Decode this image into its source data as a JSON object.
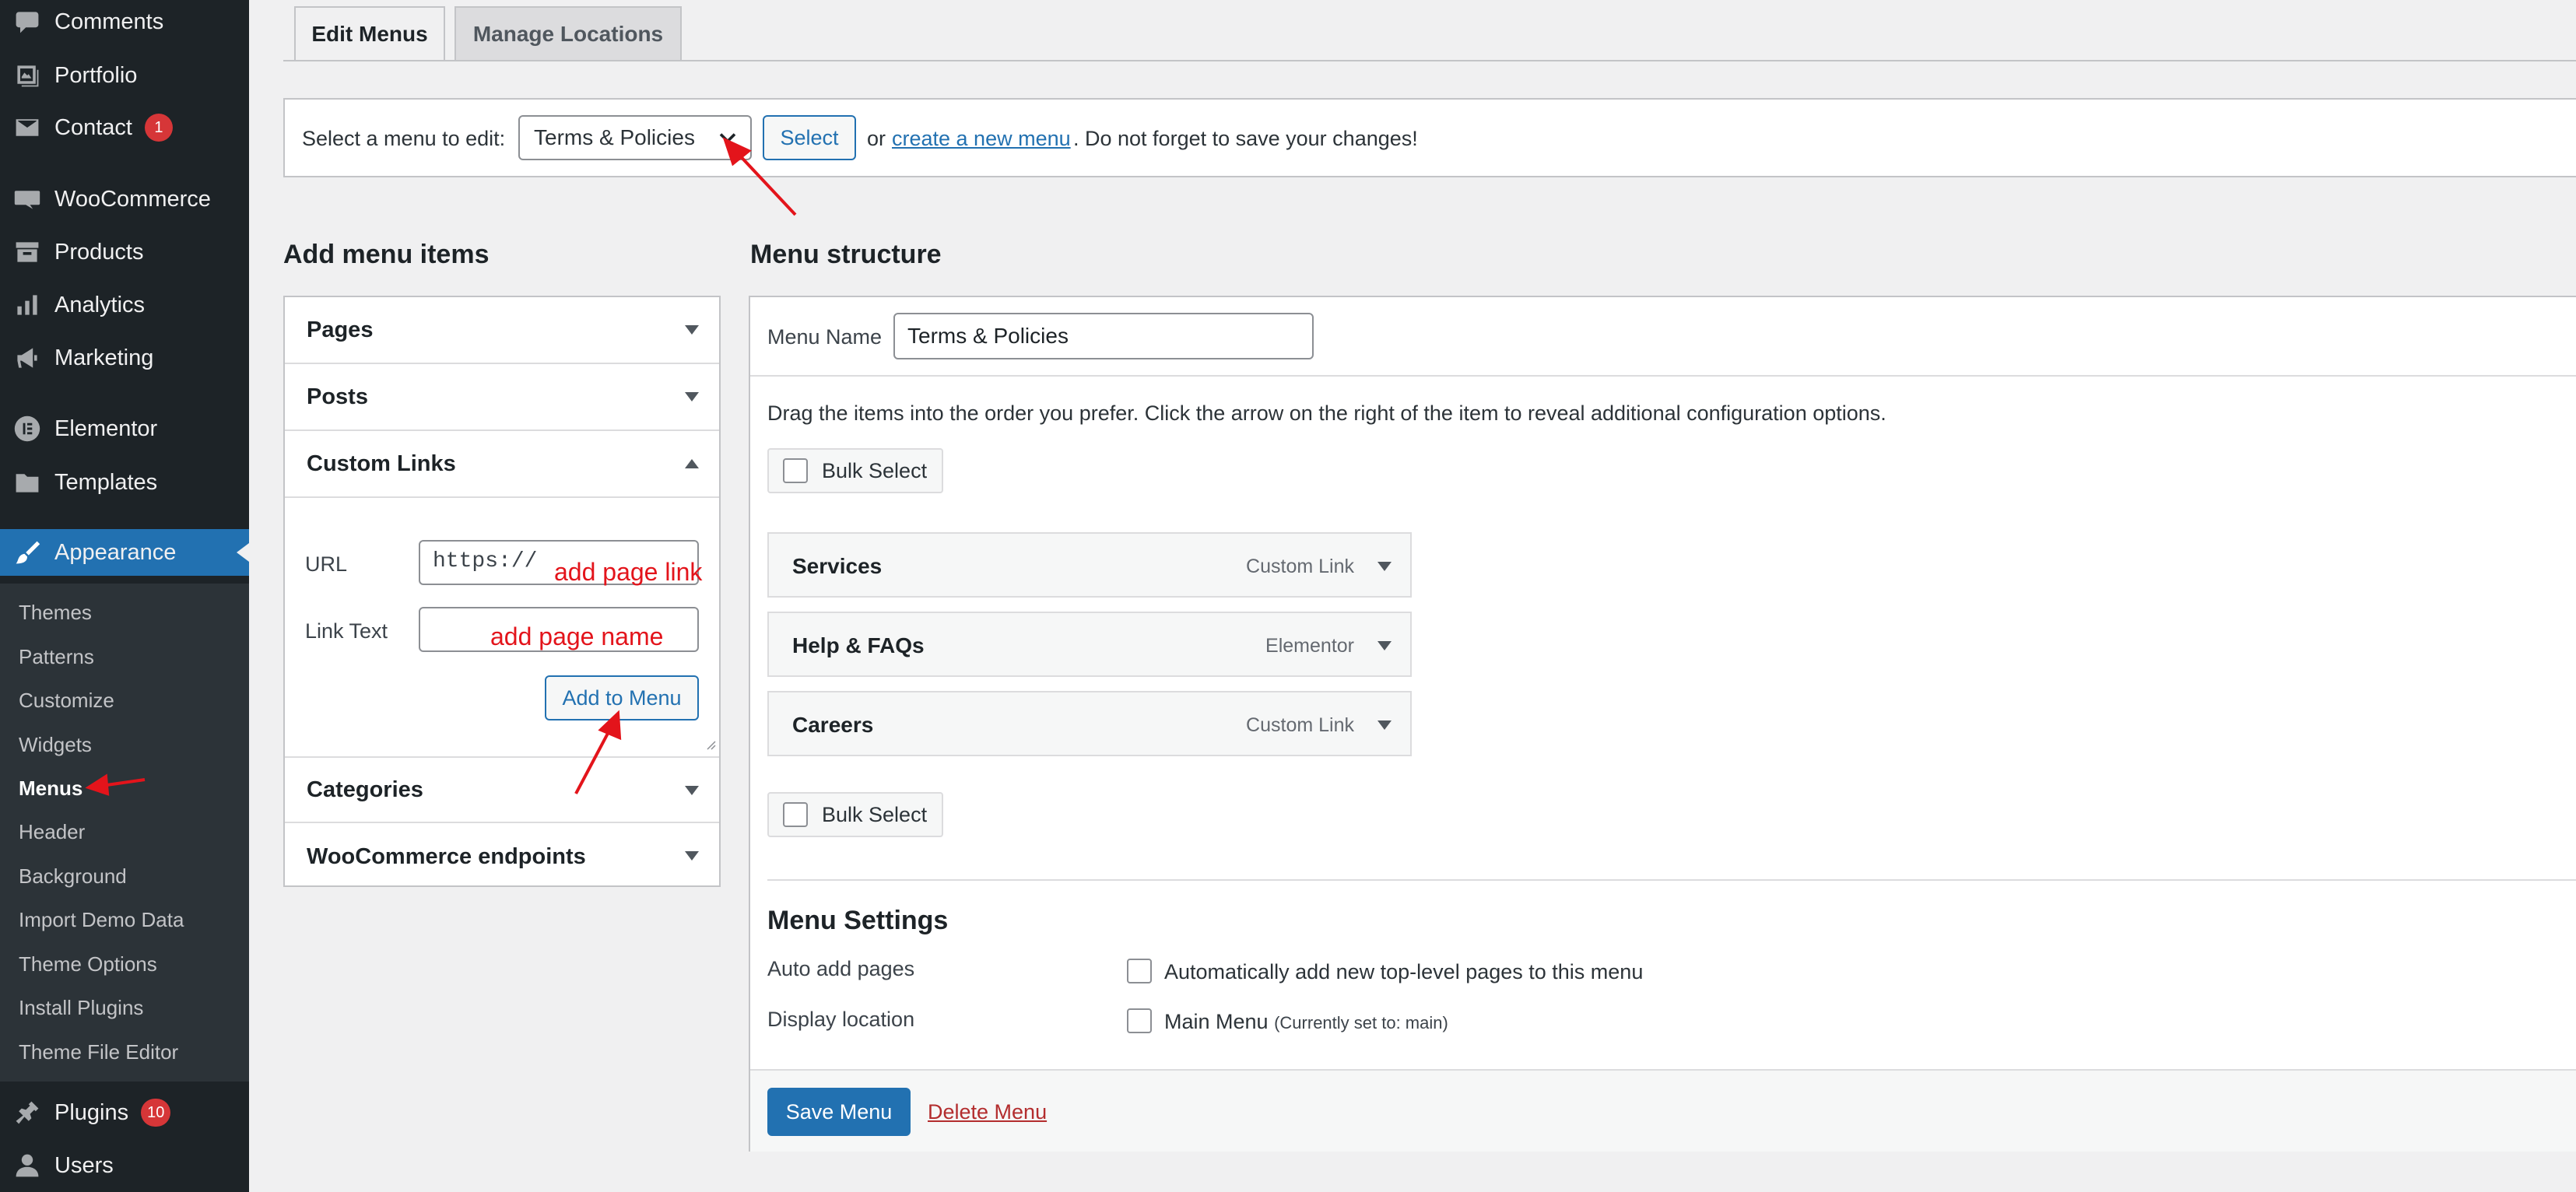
{
  "sidebar": {
    "items": [
      {
        "label": "Comments",
        "icon": "comments-icon"
      },
      {
        "label": "Portfolio",
        "icon": "portfolio-icon"
      },
      {
        "label": "Contact",
        "icon": "mail-icon",
        "badge": "1"
      },
      {
        "label": "WooCommerce",
        "icon": "woocommerce-icon"
      },
      {
        "label": "Products",
        "icon": "archive-icon"
      },
      {
        "label": "Analytics",
        "icon": "bar-chart-icon"
      },
      {
        "label": "Marketing",
        "icon": "megaphone-icon"
      },
      {
        "label": "Elementor",
        "icon": "elementor-icon"
      },
      {
        "label": "Templates",
        "icon": "folder-icon"
      },
      {
        "label": "Appearance",
        "icon": "paintbrush-icon"
      },
      {
        "label": "Plugins",
        "icon": "plugin-icon",
        "badge": "10"
      },
      {
        "label": "Users",
        "icon": "user-icon"
      }
    ],
    "submenu": [
      "Themes",
      "Patterns",
      "Customize",
      "Widgets",
      "Menus",
      "Header",
      "Background",
      "Import Demo Data",
      "Theme Options",
      "Install Plugins",
      "Theme File Editor"
    ],
    "active_item": "Appearance",
    "current_submenu": "Menus",
    "colors": {
      "background": "#1d2327",
      "active": "#2271b1",
      "badge": "#d63638"
    }
  },
  "tabs": [
    "Edit Menus",
    "Manage Locations"
  ],
  "select_bar": {
    "label": "Select a menu to edit:",
    "selected_menu": "Terms & Policies",
    "select_button": "Select",
    "or": "or",
    "create_link": "create a new menu",
    "tail": ". Do not forget to save your changes!"
  },
  "add_items": {
    "title": "Add menu items",
    "sections": [
      "Pages",
      "Posts",
      "Custom Links",
      "Categories",
      "WooCommerce endpoints"
    ],
    "url_label": "URL",
    "url_value": "https://",
    "link_text_label": "Link Text",
    "link_text_value": "",
    "add_button": "Add to Menu"
  },
  "annotations": {
    "url_note": "add page link",
    "name_note": "add page name",
    "color": "#e3141b"
  },
  "structure": {
    "title": "Menu structure",
    "menu_name_label": "Menu Name",
    "menu_name_value": "Terms & Policies",
    "instructions": "Drag the items into the order you prefer. Click the arrow on the right of the item to reveal additional configuration options.",
    "bulk_select": "Bulk Select",
    "items": [
      {
        "title": "Services",
        "type": "Custom Link"
      },
      {
        "title": "Help & FAQs",
        "type": "Elementor"
      },
      {
        "title": "Careers",
        "type": "Custom Link"
      }
    ]
  },
  "settings": {
    "title": "Menu Settings",
    "auto_add_label": "Auto add pages",
    "auto_add_text": "Automatically add new top-level pages to this menu",
    "display_label": "Display location",
    "display_text": "Main Menu",
    "display_note": "(Currently set to: main)"
  },
  "footer": {
    "save": "Save Menu",
    "delete": "Delete Menu"
  }
}
